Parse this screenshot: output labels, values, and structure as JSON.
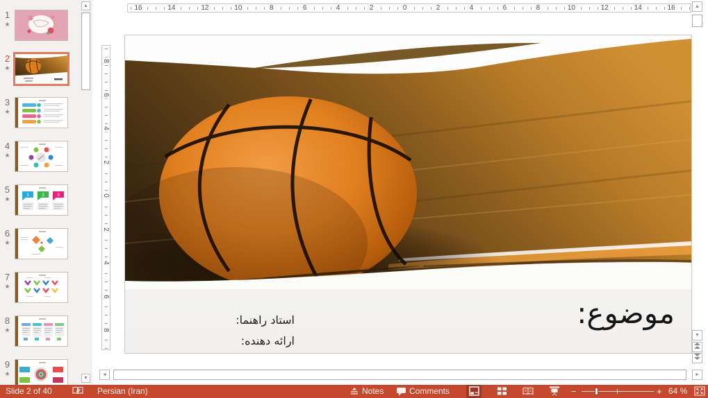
{
  "colors": {
    "status_bar": "#C4492E",
    "status_bar_pressed": "#9E3920",
    "selection_border": "#E2795B",
    "selected_slide_number": "#C74634"
  },
  "icons": {
    "star": "★",
    "scroll_up": "▲",
    "scroll_down": "▼",
    "scroll_left": "◄",
    "scroll_right": "►"
  },
  "thumbnail_panel": {
    "slides": [
      {
        "number": "1",
        "starred": true,
        "selected": false,
        "kind": "floral"
      },
      {
        "number": "2",
        "starred": true,
        "selected": true,
        "kind": "basketball"
      },
      {
        "number": "3",
        "starred": true,
        "selected": false,
        "kind": "list-bars"
      },
      {
        "number": "4",
        "starred": true,
        "selected": false,
        "kind": "circle-diagram"
      },
      {
        "number": "5",
        "starred": true,
        "selected": false,
        "kind": "three-tags",
        "tags": [
          "1",
          "2",
          "3"
        ]
      },
      {
        "number": "6",
        "starred": true,
        "selected": false,
        "kind": "diamonds"
      },
      {
        "number": "7",
        "starred": true,
        "selected": false,
        "kind": "chevron-timeline"
      },
      {
        "number": "8",
        "starred": true,
        "selected": false,
        "kind": "four-cards"
      },
      {
        "number": "9",
        "starred": true,
        "selected": false,
        "kind": "target"
      }
    ]
  },
  "rulers": {
    "horizontal": [
      "16",
      "14",
      "12",
      "10",
      "8",
      "6",
      "4",
      "2",
      "0",
      "2",
      "4",
      "6",
      "8",
      "10",
      "12",
      "14",
      "16"
    ],
    "vertical": [
      "8",
      "6",
      "4",
      "2",
      "0",
      "2",
      "4",
      "6",
      "8"
    ]
  },
  "slide": {
    "title": "موضوع:",
    "advisor_label": "استاد راهنما:",
    "presenter_label": "ارائه دهنده:"
  },
  "status_bar": {
    "slide_indicator": "Slide 2 of 40",
    "language": "Persian (Iran)",
    "notes_label": "Notes",
    "comments_label": "Comments",
    "zoom_minus": "−",
    "zoom_plus": "+",
    "zoom_percent": "64 %"
  }
}
